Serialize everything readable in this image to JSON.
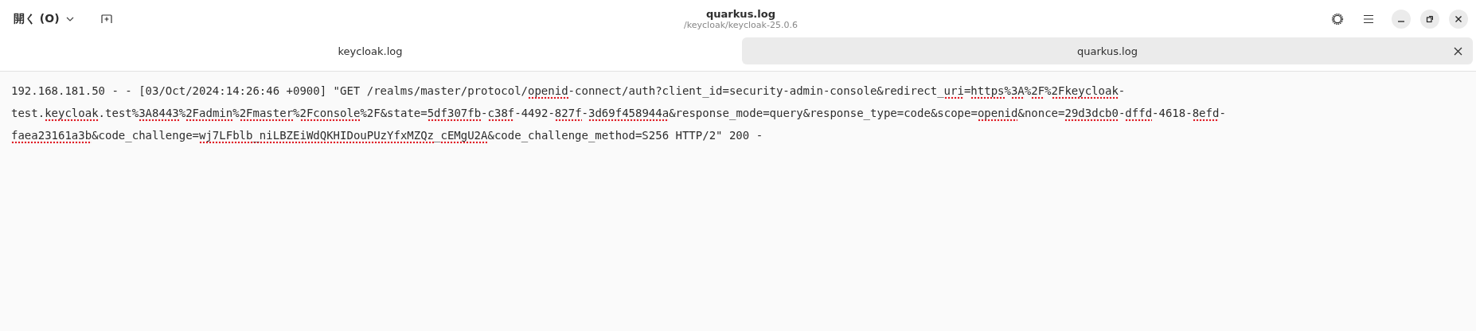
{
  "window": {
    "title": "quarkus.log",
    "subtitle": "/keycloak/keycloak-25.0.6"
  },
  "open_button": {
    "label": "開く (O)"
  },
  "tabs": [
    {
      "label": "keycloak.log",
      "selected": false
    },
    {
      "label": "quarkus.log",
      "selected": true
    }
  ],
  "editor": {
    "segments": [
      {
        "text": "192.168.181.50 - - [03/Oct/2024:14:26:46 +0900] \"GET /realms/master/protocol/",
        "misspelled": false
      },
      {
        "text": "openid",
        "misspelled": true
      },
      {
        "text": "-connect/auth?client_id=security-admin-console&redirect_",
        "misspelled": false
      },
      {
        "text": "uri",
        "misspelled": true
      },
      {
        "text": "=",
        "misspelled": false
      },
      {
        "text": "https",
        "misspelled": true
      },
      {
        "text": "%",
        "misspelled": false
      },
      {
        "text": "3A",
        "misspelled": true
      },
      {
        "text": "%",
        "misspelled": false
      },
      {
        "text": "2F",
        "misspelled": true
      },
      {
        "text": "%",
        "misspelled": false
      },
      {
        "text": "2Fkeycloak",
        "misspelled": true
      },
      {
        "text": "-test.",
        "misspelled": false
      },
      {
        "text": "keycloak",
        "misspelled": true
      },
      {
        "text": ".test%",
        "misspelled": false
      },
      {
        "text": "3A8443",
        "misspelled": true
      },
      {
        "text": "%",
        "misspelled": false
      },
      {
        "text": "2Fadmin",
        "misspelled": true
      },
      {
        "text": "%",
        "misspelled": false
      },
      {
        "text": "2Fmaster",
        "misspelled": true
      },
      {
        "text": "%",
        "misspelled": false
      },
      {
        "text": "2Fconsole",
        "misspelled": true
      },
      {
        "text": "%2F&state=",
        "misspelled": false
      },
      {
        "text": "5df307fb",
        "misspelled": true
      },
      {
        "text": "-",
        "misspelled": false
      },
      {
        "text": "c38f",
        "misspelled": true
      },
      {
        "text": "-4492-",
        "misspelled": false
      },
      {
        "text": "827f",
        "misspelled": true
      },
      {
        "text": "-",
        "misspelled": false
      },
      {
        "text": "3d69f458944a",
        "misspelled": true
      },
      {
        "text": "&response_mode=query&response_type=code&scope=",
        "misspelled": false
      },
      {
        "text": "openid",
        "misspelled": true
      },
      {
        "text": "&nonce=",
        "misspelled": false
      },
      {
        "text": "29d3dcb0",
        "misspelled": true
      },
      {
        "text": "-",
        "misspelled": false
      },
      {
        "text": "dffd",
        "misspelled": true
      },
      {
        "text": "-4618-",
        "misspelled": false
      },
      {
        "text": "8efd",
        "misspelled": true
      },
      {
        "text": "-",
        "misspelled": false
      },
      {
        "text": "faea23161a3b",
        "misspelled": true
      },
      {
        "text": "&code_challenge=",
        "misspelled": false
      },
      {
        "text": "wj7LFblb_niLBZEiWdQKHIDouPUzYfxMZQz",
        "misspelled": true
      },
      {
        "text": "_",
        "misspelled": false
      },
      {
        "text": "cEMgU2A",
        "misspelled": true
      },
      {
        "text": "&code_challenge_method=S256 HTTP/2\" 200 -",
        "misspelled": false
      }
    ]
  }
}
